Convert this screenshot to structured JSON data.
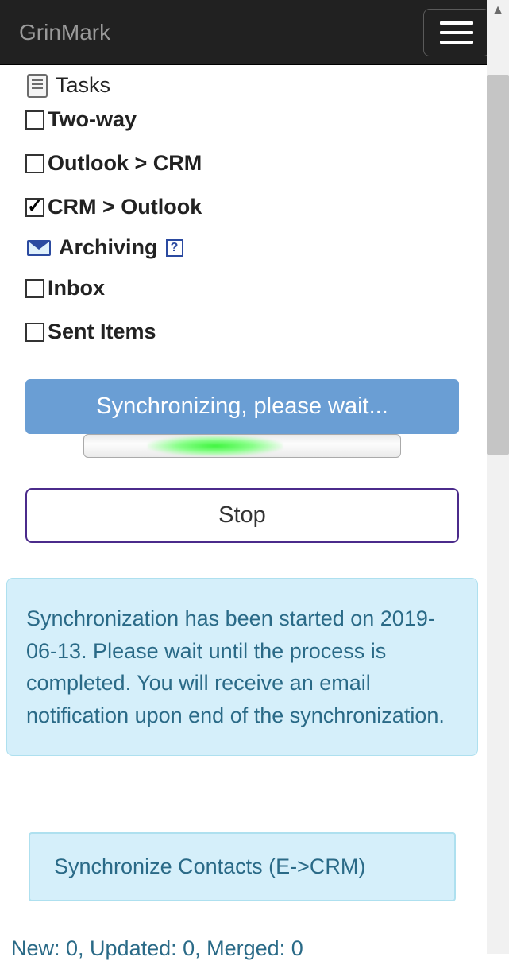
{
  "nav": {
    "brand": "GrinMark"
  },
  "sections": {
    "tasks_label": "Tasks",
    "archiving_label": "Archiving"
  },
  "options": {
    "two_way": {
      "label": "Two-way",
      "checked": false
    },
    "outlook_to_crm": {
      "label": "Outlook > CRM",
      "checked": false
    },
    "crm_to_outlook": {
      "label": "CRM > Outlook",
      "checked": true
    },
    "inbox": {
      "label": "Inbox",
      "checked": false
    },
    "sent_items": {
      "label": "Sent Items",
      "checked": false
    }
  },
  "sync": {
    "status_label": "Synchronizing, please wait...",
    "stop_label": "Stop",
    "info_text": "Synchronization has been started on 2019-06-13. Please wait until the process is completed. You will receive an email notification upon end of the synchronization.",
    "step_label": "Synchronize Contacts (E->CRM)",
    "counts_text": "New: 0, Updated: 0, Merged: 0"
  }
}
